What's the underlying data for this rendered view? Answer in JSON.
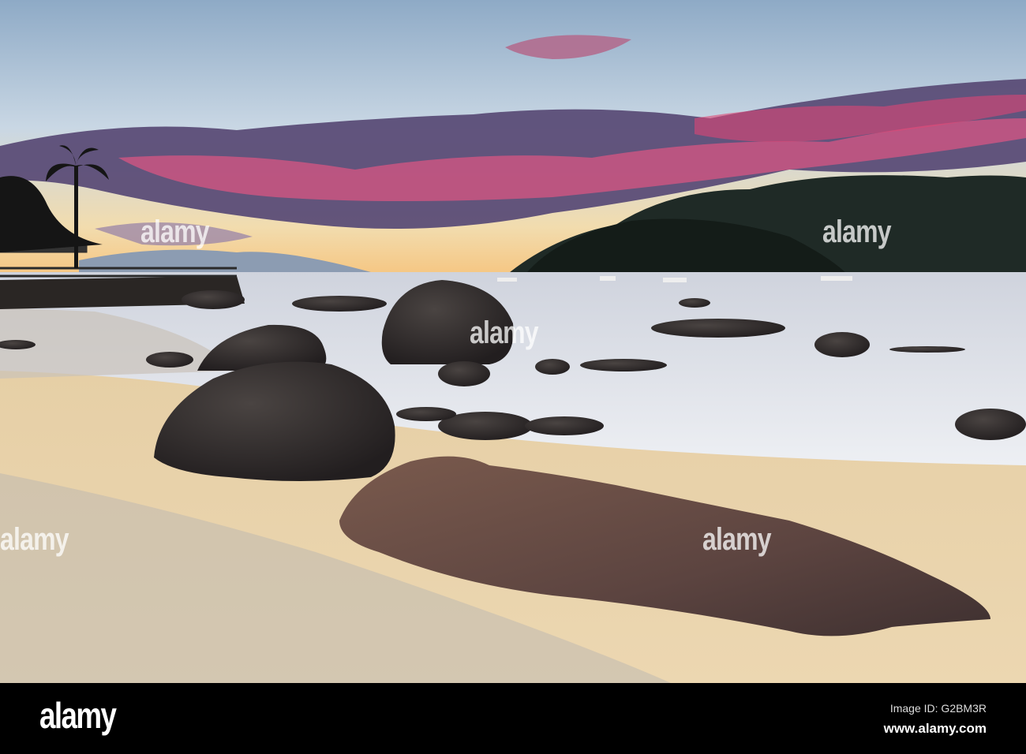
{
  "photo": {
    "subject": "beach-sunset-with-rocks",
    "colors": {
      "sky_top": "#9fb6cc",
      "sky_horizon": "#f5d9a0",
      "cloud_pink": "#e2477a",
      "cloud_purple": "#5a4a78",
      "water": "#e6e8ee",
      "sand": "#e9d3ac",
      "rock": "#3a3433",
      "rock_front": "#6b4d44"
    }
  },
  "watermark": {
    "text": "alamy"
  },
  "footer": {
    "logo": "alamy",
    "image_id": "Image ID: G2BM3R",
    "website": "www.alamy.com"
  }
}
